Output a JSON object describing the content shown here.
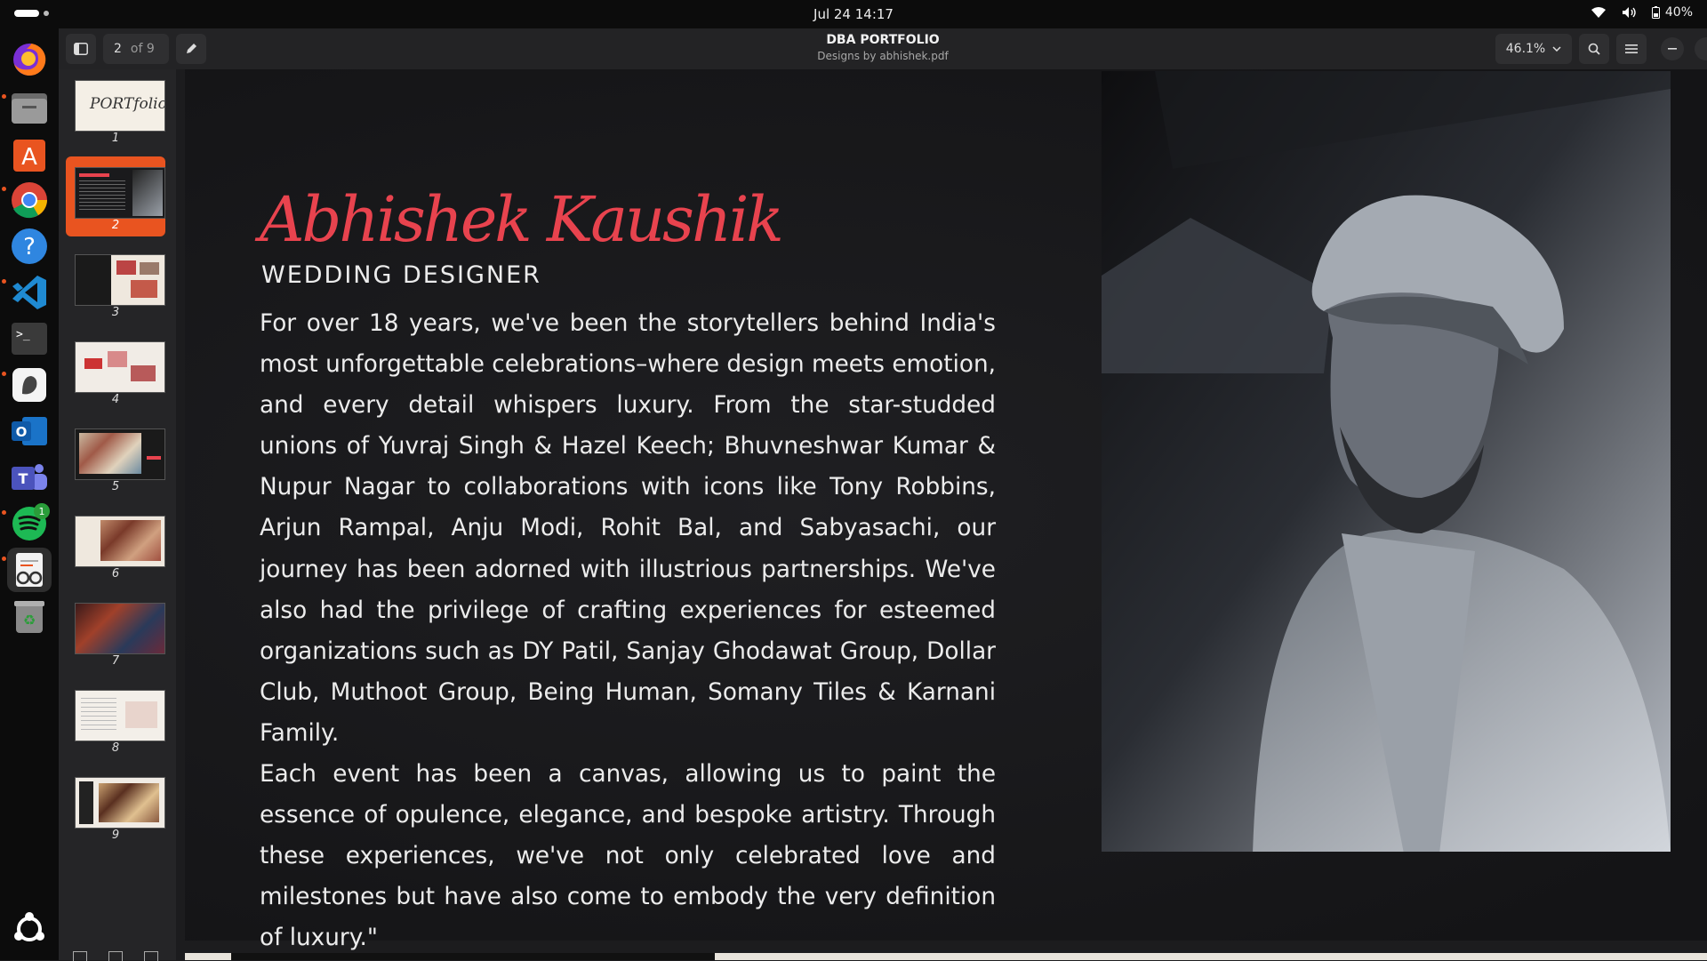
{
  "topbar": {
    "clock": "Jul 24  14:17",
    "battery": "40%"
  },
  "dock": {
    "items": [
      "firefox-icon",
      "files-icon",
      "app-center-icon",
      "chrome-icon",
      "help-icon",
      "vscode-icon",
      "terminal-icon",
      "clipart-icon",
      "outlook-icon",
      "teams-icon",
      "spotify-icon",
      "document-viewer-icon",
      "trash-icon"
    ],
    "spotify_badge": "1"
  },
  "header": {
    "page_number": "2",
    "page_total": "of 9",
    "title": "DBA PORTFOLIO",
    "subtitle": "Designs by abhishek.pdf",
    "zoom": "46.1%"
  },
  "sidebar": {
    "pages": [
      {
        "num": "1",
        "title_text": "PORTfolio"
      },
      {
        "num": "2"
      },
      {
        "num": "3"
      },
      {
        "num": "4"
      },
      {
        "num": "5"
      },
      {
        "num": "6"
      },
      {
        "num": "7"
      },
      {
        "num": "8"
      },
      {
        "num": "9"
      }
    ],
    "current_page": 2
  },
  "page": {
    "name": "Abhishek Kaushik",
    "role": "WEDDING DESIGNER",
    "paragraph1": "For over 18 years, we've been the storytellers behind India's most unforgettable celebrations–where design meets emotion, and every detail whispers luxury. From the star-studded unions of Yuvraj Singh & Hazel Keech; Bhuvneshwar Kumar & Nupur Nagar to collaborations with icons like Tony Robbins, Arjun Rampal, Anju Modi, Rohit Bal, and Sabyasachi, our journey has been adorned with illustrious partnerships. We've also had the privilege of crafting experiences for esteemed organizations such as DY Patil,  Sanjay Ghodawat Group, Dollar Club, Muthoot Group, Being Human,  Somany Tiles & Karnani Family.",
    "paragraph2": "Each event has been a canvas, allowing us to paint the essence of opulence, elegance, and bespoke artistry. Through these experiences, we've not only celebrated love and milestones but have also come to embody the very definition of luxury.\""
  },
  "colors": {
    "accent": "#e95420",
    "name_red": "#e8434e"
  }
}
